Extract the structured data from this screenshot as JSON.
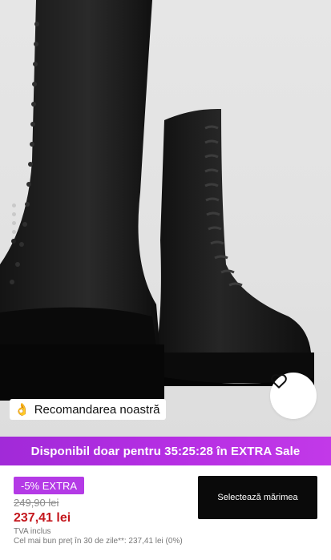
{
  "product_image": {
    "alt": ""
  },
  "gallery": {
    "dots_count": 5,
    "active_index": 4
  },
  "recommendation_badge": {
    "icon": "ok-hand-icon",
    "label": "Recomandarea noastră"
  },
  "favorite": {
    "icon": "heart-outline-icon"
  },
  "promo_banner": {
    "text": "Disponibil doar pentru 35:25:28 în EXTRA Sale",
    "color": "#b52ee3"
  },
  "pricing": {
    "discount_badge": "-5% EXTRA",
    "old_price": "249,90 lei",
    "price": "237,41 lei",
    "vat_note": "TVA inclus",
    "lowest_price_note": "Cel mai bun preț în 30 de zile**: 237,41 lei (0%)",
    "price_color": "#c4171d",
    "badge_color": "#b43ae6"
  },
  "actions": {
    "select_size_label": "Selectează mărimea"
  }
}
